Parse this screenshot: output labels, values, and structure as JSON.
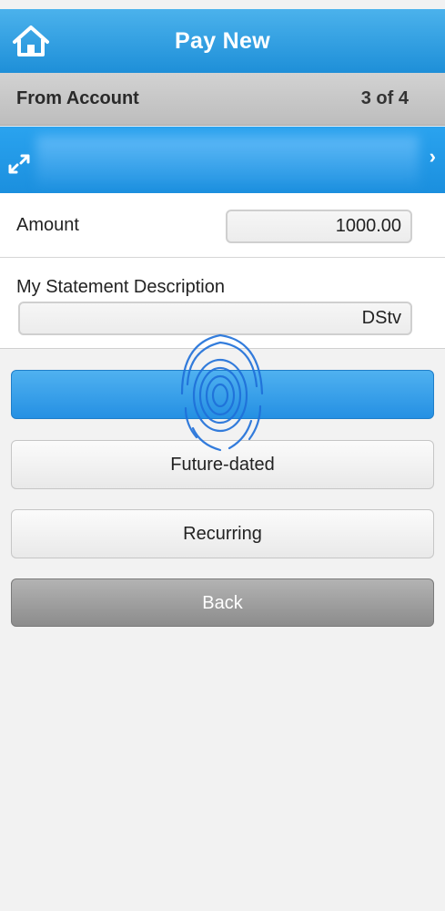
{
  "header": {
    "title": "Pay New",
    "home_icon": "home-icon"
  },
  "from_account": {
    "label": "From Account",
    "counter": "3 of 4"
  },
  "account_row": {
    "swap_icon": "swap-arrows-icon",
    "chevron_icon": "chevron-right-icon"
  },
  "amount": {
    "label": "Amount",
    "value": "1000.00"
  },
  "statement": {
    "label": "My Statement Description",
    "value": "DStv"
  },
  "buttons": {
    "primary_label": "",
    "future_label": "Future-dated",
    "recurring_label": "Recurring",
    "back_label": "Back"
  },
  "overlay": {
    "icon": "fingerprint-icon",
    "color": "#1e6fd9"
  },
  "colors": {
    "accent": "#2590e3",
    "header": "#1e8fd8",
    "bar": "#c8c8c8"
  }
}
